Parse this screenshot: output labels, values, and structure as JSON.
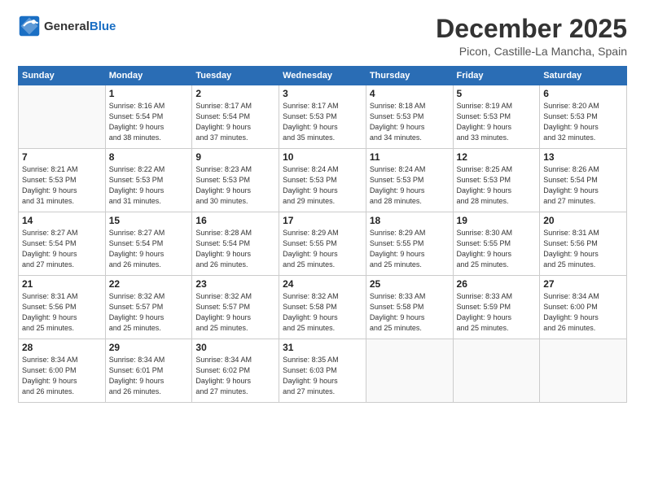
{
  "header": {
    "logo_line1": "General",
    "logo_line2": "Blue",
    "month_title": "December 2025",
    "subtitle": "Picon, Castille-La Mancha, Spain"
  },
  "weekdays": [
    "Sunday",
    "Monday",
    "Tuesday",
    "Wednesday",
    "Thursday",
    "Friday",
    "Saturday"
  ],
  "weeks": [
    [
      {
        "day": "",
        "info": ""
      },
      {
        "day": "1",
        "info": "Sunrise: 8:16 AM\nSunset: 5:54 PM\nDaylight: 9 hours\nand 38 minutes."
      },
      {
        "day": "2",
        "info": "Sunrise: 8:17 AM\nSunset: 5:54 PM\nDaylight: 9 hours\nand 37 minutes."
      },
      {
        "day": "3",
        "info": "Sunrise: 8:17 AM\nSunset: 5:53 PM\nDaylight: 9 hours\nand 35 minutes."
      },
      {
        "day": "4",
        "info": "Sunrise: 8:18 AM\nSunset: 5:53 PM\nDaylight: 9 hours\nand 34 minutes."
      },
      {
        "day": "5",
        "info": "Sunrise: 8:19 AM\nSunset: 5:53 PM\nDaylight: 9 hours\nand 33 minutes."
      },
      {
        "day": "6",
        "info": "Sunrise: 8:20 AM\nSunset: 5:53 PM\nDaylight: 9 hours\nand 32 minutes."
      }
    ],
    [
      {
        "day": "7",
        "info": "Sunrise: 8:21 AM\nSunset: 5:53 PM\nDaylight: 9 hours\nand 31 minutes."
      },
      {
        "day": "8",
        "info": "Sunrise: 8:22 AM\nSunset: 5:53 PM\nDaylight: 9 hours\nand 31 minutes."
      },
      {
        "day": "9",
        "info": "Sunrise: 8:23 AM\nSunset: 5:53 PM\nDaylight: 9 hours\nand 30 minutes."
      },
      {
        "day": "10",
        "info": "Sunrise: 8:24 AM\nSunset: 5:53 PM\nDaylight: 9 hours\nand 29 minutes."
      },
      {
        "day": "11",
        "info": "Sunrise: 8:24 AM\nSunset: 5:53 PM\nDaylight: 9 hours\nand 28 minutes."
      },
      {
        "day": "12",
        "info": "Sunrise: 8:25 AM\nSunset: 5:53 PM\nDaylight: 9 hours\nand 28 minutes."
      },
      {
        "day": "13",
        "info": "Sunrise: 8:26 AM\nSunset: 5:54 PM\nDaylight: 9 hours\nand 27 minutes."
      }
    ],
    [
      {
        "day": "14",
        "info": "Sunrise: 8:27 AM\nSunset: 5:54 PM\nDaylight: 9 hours\nand 27 minutes."
      },
      {
        "day": "15",
        "info": "Sunrise: 8:27 AM\nSunset: 5:54 PM\nDaylight: 9 hours\nand 26 minutes."
      },
      {
        "day": "16",
        "info": "Sunrise: 8:28 AM\nSunset: 5:54 PM\nDaylight: 9 hours\nand 26 minutes."
      },
      {
        "day": "17",
        "info": "Sunrise: 8:29 AM\nSunset: 5:55 PM\nDaylight: 9 hours\nand 25 minutes."
      },
      {
        "day": "18",
        "info": "Sunrise: 8:29 AM\nSunset: 5:55 PM\nDaylight: 9 hours\nand 25 minutes."
      },
      {
        "day": "19",
        "info": "Sunrise: 8:30 AM\nSunset: 5:55 PM\nDaylight: 9 hours\nand 25 minutes."
      },
      {
        "day": "20",
        "info": "Sunrise: 8:31 AM\nSunset: 5:56 PM\nDaylight: 9 hours\nand 25 minutes."
      }
    ],
    [
      {
        "day": "21",
        "info": "Sunrise: 8:31 AM\nSunset: 5:56 PM\nDaylight: 9 hours\nand 25 minutes."
      },
      {
        "day": "22",
        "info": "Sunrise: 8:32 AM\nSunset: 5:57 PM\nDaylight: 9 hours\nand 25 minutes."
      },
      {
        "day": "23",
        "info": "Sunrise: 8:32 AM\nSunset: 5:57 PM\nDaylight: 9 hours\nand 25 minutes."
      },
      {
        "day": "24",
        "info": "Sunrise: 8:32 AM\nSunset: 5:58 PM\nDaylight: 9 hours\nand 25 minutes."
      },
      {
        "day": "25",
        "info": "Sunrise: 8:33 AM\nSunset: 5:58 PM\nDaylight: 9 hours\nand 25 minutes."
      },
      {
        "day": "26",
        "info": "Sunrise: 8:33 AM\nSunset: 5:59 PM\nDaylight: 9 hours\nand 25 minutes."
      },
      {
        "day": "27",
        "info": "Sunrise: 8:34 AM\nSunset: 6:00 PM\nDaylight: 9 hours\nand 26 minutes."
      }
    ],
    [
      {
        "day": "28",
        "info": "Sunrise: 8:34 AM\nSunset: 6:00 PM\nDaylight: 9 hours\nand 26 minutes."
      },
      {
        "day": "29",
        "info": "Sunrise: 8:34 AM\nSunset: 6:01 PM\nDaylight: 9 hours\nand 26 minutes."
      },
      {
        "day": "30",
        "info": "Sunrise: 8:34 AM\nSunset: 6:02 PM\nDaylight: 9 hours\nand 27 minutes."
      },
      {
        "day": "31",
        "info": "Sunrise: 8:35 AM\nSunset: 6:03 PM\nDaylight: 9 hours\nand 27 minutes."
      },
      {
        "day": "",
        "info": ""
      },
      {
        "day": "",
        "info": ""
      },
      {
        "day": "",
        "info": ""
      }
    ]
  ]
}
